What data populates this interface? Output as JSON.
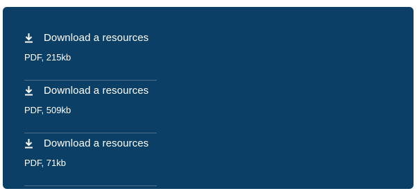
{
  "resources": [
    {
      "label": "Download a resources",
      "meta": "PDF, 215kb",
      "icon": "download-icon"
    },
    {
      "label": "Download a resources",
      "meta": "PDF, 509kb",
      "icon": "download-icon"
    },
    {
      "label": "Download a resources",
      "meta": "PDF, 71kb",
      "icon": "download-icon"
    }
  ],
  "colors": {
    "panel_bg": "#0b3f66",
    "text": "#ffffff",
    "divider": "#4d6f8c"
  }
}
